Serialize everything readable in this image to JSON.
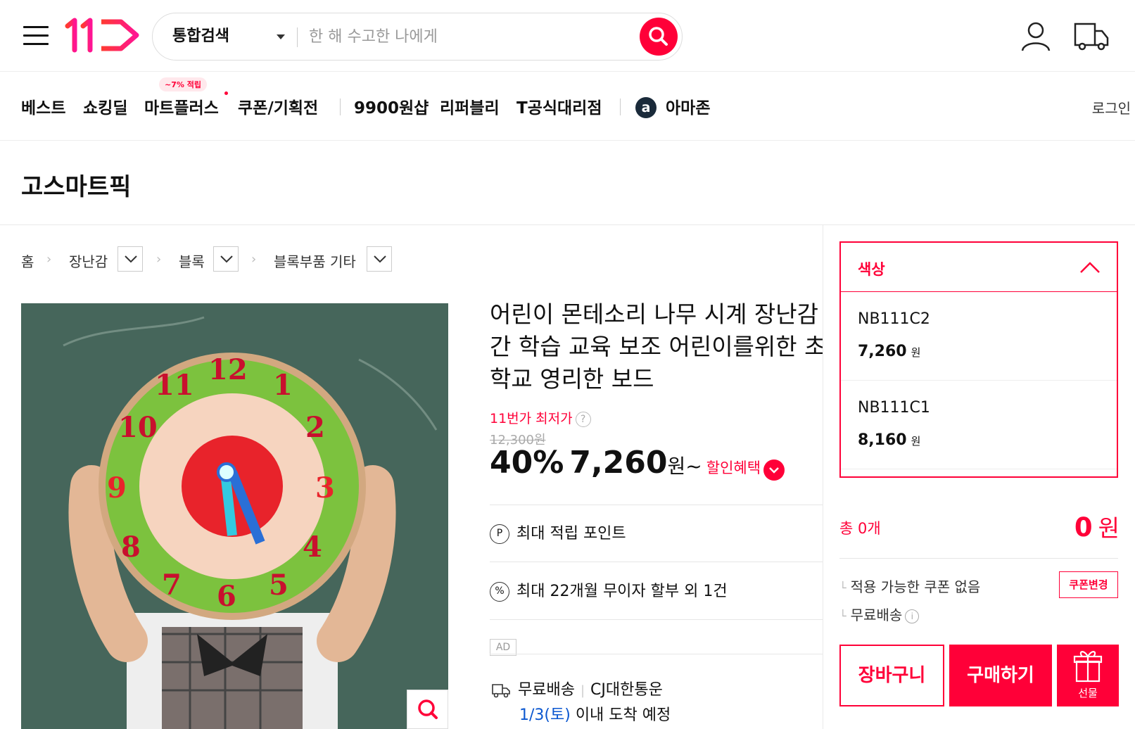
{
  "header": {
    "logo_text": "11",
    "search": {
      "scope": "통합검색",
      "placeholder": "한 해 수고한 나에게"
    }
  },
  "nav": {
    "items": [
      "베스트",
      "쇼킹딜",
      "마트플러스",
      "쿠폰/기획전",
      "9900원샵",
      "리퍼블리",
      "T공식대리점",
      "아마존"
    ],
    "badge": "~7% 적립",
    "amazon_glyph": "a",
    "login": "로그인"
  },
  "store": {
    "title": "고스마트픽"
  },
  "breadcrumb": {
    "home": "홈",
    "level1": "장난감",
    "level2": "블록",
    "level3": "블록부품 기타"
  },
  "product": {
    "title_lines": [
      "어린이 몬테소리 나무 시계 장난감 시",
      "간 학습 교육 보조 어린이를위한 초등",
      "학교 영리한 보드"
    ],
    "lowest_label": "11번가 최저가",
    "original_price": "12,300원",
    "discount": "40%",
    "price": "7,260",
    "price_unit": "원~",
    "benefit_label": "할인혜택",
    "points_label": "최대 적립 포인트",
    "installment_label": "최대 22개월 무이자 할부 외 1건",
    "ad_label": "AD",
    "shipping_label": "무료배송",
    "carrier": "CJ대한통운",
    "arrival_date": "1/3(토)",
    "arrival_suffix": "이내 도착 예정"
  },
  "options": {
    "header": "색상",
    "items": [
      {
        "name": "NB111C2",
        "price": "7,260",
        "unit": "원"
      },
      {
        "name": "NB111C1",
        "price": "8,160",
        "unit": "원"
      }
    ]
  },
  "summary": {
    "total_count": "총 0개",
    "total_price": "0",
    "total_unit": "원",
    "coupon_text": "적용 가능한 쿠폰 없음",
    "coupon_button": "쿠폰변경",
    "shipping_text": "무료배송"
  },
  "actions": {
    "cart": "장바구니",
    "buy": "구매하기",
    "gift": "선물"
  },
  "colors": {
    "accent": "#ff0038",
    "link": "#0b57d0"
  }
}
